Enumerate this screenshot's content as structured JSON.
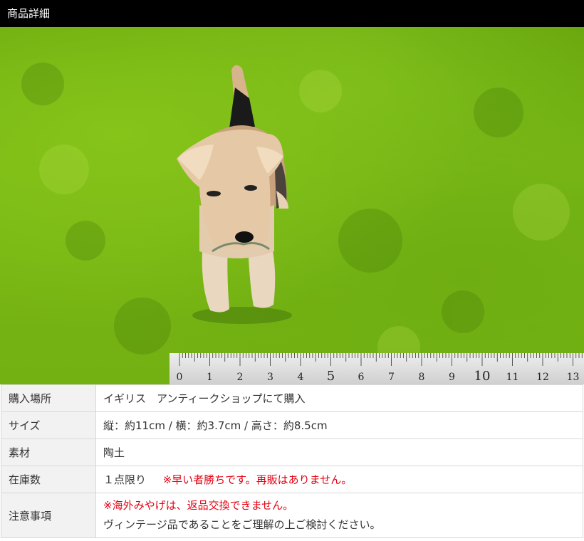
{
  "header": {
    "title": "商品詳細"
  },
  "photo": {
    "subject": "dog-figurine",
    "ruler_numbers": [
      "0",
      "1",
      "2",
      "3",
      "4",
      "5",
      "6",
      "7",
      "8",
      "9",
      "10",
      "11",
      "12",
      "13"
    ]
  },
  "specs": {
    "rows": [
      {
        "label": "購入場所",
        "value": "イギリス　アンティークショップにて購入"
      },
      {
        "label": "サイズ",
        "value": "縦：約11cm / 横：約3.7cm / 高さ：約8.5cm"
      },
      {
        "label": "素材",
        "value": "陶土"
      },
      {
        "label": "在庫数",
        "value": "１点限り",
        "note": "※早い者勝ちです。再販はありません。"
      },
      {
        "label": "注意事項",
        "line1": "※海外みやげは、返品交換できません。",
        "line2": "ヴィンテージ品であることをご理解の上ご検討ください。"
      }
    ]
  },
  "colors": {
    "header_bg": "#000000",
    "grass": "#79b815",
    "alert": "#e60012",
    "label_bg": "#f2f2f2"
  }
}
